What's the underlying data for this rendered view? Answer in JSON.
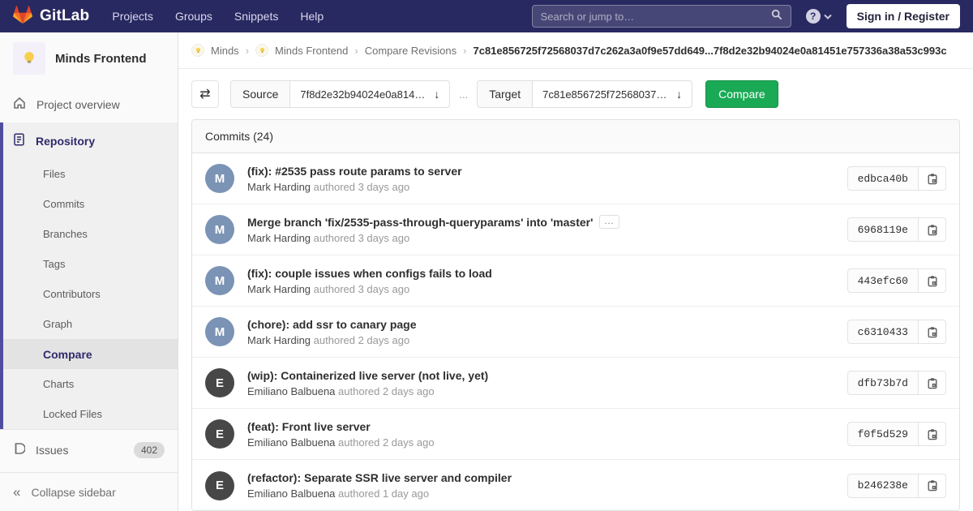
{
  "navbar": {
    "logo_text": "GitLab",
    "links": [
      "Projects",
      "Groups",
      "Snippets",
      "Help"
    ],
    "search_placeholder": "Search or jump to…",
    "help_glyph": "?",
    "sign_in_label": "Sign in / Register"
  },
  "sidebar": {
    "project_name": "Minds Frontend",
    "project_overview_label": "Project overview",
    "repository_label": "Repository",
    "repo_subitems": [
      "Files",
      "Commits",
      "Branches",
      "Tags",
      "Contributors",
      "Graph",
      "Compare",
      "Charts",
      "Locked Files"
    ],
    "active_subitem": "Compare",
    "issues_label": "Issues",
    "issues_count": "402",
    "collapse_label": "Collapse sidebar",
    "collapse_glyph": "«"
  },
  "breadcrumb": {
    "group": "Minds",
    "project": "Minds Frontend",
    "page": "Compare Revisions",
    "current": "7c81e856725f72568037d7c262a3a0f9e57dd649...7f8d2e32b94024e0a81451e757336a38a53c993c"
  },
  "compare_form": {
    "swap_glyph": "⇄",
    "source_label": "Source",
    "source_value": "7f8d2e32b94024e0a814…",
    "arrow_glyph": "↓",
    "separator": "...",
    "target_label": "Target",
    "target_value": "7c81e856725f72568037…",
    "compare_button": "Compare"
  },
  "commits_panel": {
    "header": "Commits (24)",
    "ellipsis_label": "...",
    "commits": [
      {
        "title": "(fix): #2535 pass route params to server",
        "author": "Mark Harding",
        "meta": "authored 3 days ago",
        "sha": "edbca40b",
        "initial": "M"
      },
      {
        "title": "Merge branch 'fix/2535-pass-through-queryparams' into 'master'",
        "author": "Mark Harding",
        "meta": "authored 3 days ago",
        "sha": "6968119e",
        "initial": "M"
      },
      {
        "title": "(fix): couple issues when configs fails to load",
        "author": "Mark Harding",
        "meta": "authored 3 days ago",
        "sha": "443efc60",
        "initial": "M"
      },
      {
        "title": "(chore): add ssr to canary page",
        "author": "Mark Harding",
        "meta": "authored 2 days ago",
        "sha": "c6310433",
        "initial": "M"
      },
      {
        "title": "(wip): Containerized live server (not live, yet)",
        "author": "Emiliano Balbuena",
        "meta": "authored 2 days ago",
        "sha": "dfb73b7d",
        "initial": "E"
      },
      {
        "title": "(feat): Front live server",
        "author": "Emiliano Balbuena",
        "meta": "authored 2 days ago",
        "sha": "f0f5d529",
        "initial": "E"
      },
      {
        "title": "(refactor): Separate SSR live server and compiler",
        "author": "Emiliano Balbuena",
        "meta": "authored 1 day ago",
        "sha": "b246238e",
        "initial": "E"
      }
    ]
  },
  "colors": {
    "navbar_bg": "#292961",
    "sidebar_accent": "#514d9e",
    "active_text": "#2f2a6b",
    "compare_button_green": "#1aaa55",
    "avatar_mark": "#7b93b5",
    "avatar_emiliano": "#474747",
    "bulb_yellow": "#f7cf4c"
  }
}
